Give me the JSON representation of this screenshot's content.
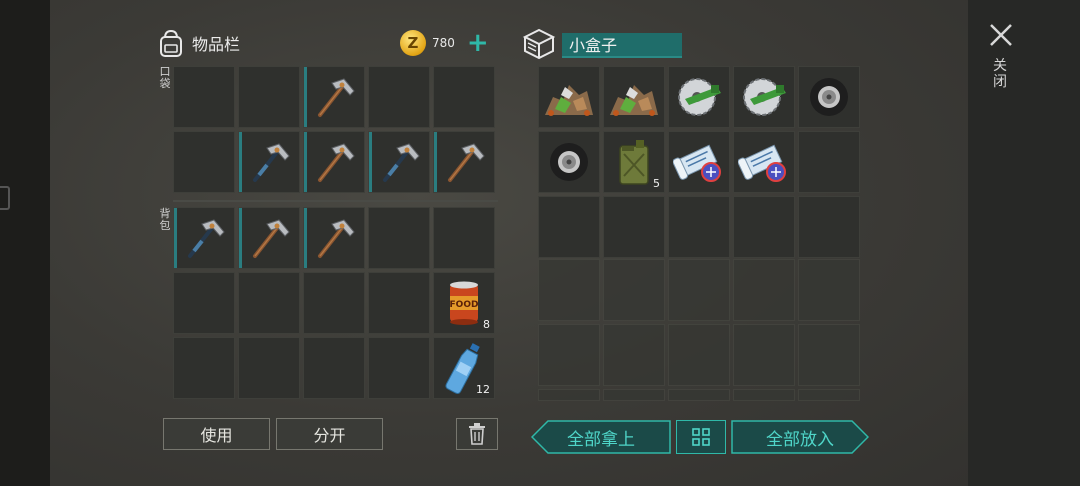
{
  "inventory": {
    "title": "物品栏",
    "coin_symbol": "Z",
    "coins": "780",
    "add_coins": "+",
    "pocket_label": "口袋",
    "backpack_label": "背包",
    "pocket": [
      {
        "icon": ""
      },
      {
        "icon": ""
      },
      {
        "icon": "pickaxe",
        "equip": true
      },
      {
        "icon": ""
      },
      {
        "icon": ""
      },
      {
        "icon": ""
      },
      {
        "icon": "pickaxe-blue",
        "equip": true
      },
      {
        "icon": "pickaxe",
        "equip": true
      },
      {
        "icon": "pickaxe-blue",
        "equip": true
      },
      {
        "icon": "pickaxe",
        "equip": true
      }
    ],
    "backpack": [
      {
        "icon": "pickaxe-blue",
        "equip": true
      },
      {
        "icon": "pickaxe",
        "equip": true
      },
      {
        "icon": "pickaxe",
        "equip": true
      },
      {
        "icon": ""
      },
      {
        "icon": ""
      },
      {
        "icon": ""
      },
      {
        "icon": ""
      },
      {
        "icon": ""
      },
      {
        "icon": ""
      },
      {
        "icon": "canned-food",
        "qty": "8"
      },
      {
        "icon": ""
      },
      {
        "icon": ""
      },
      {
        "icon": ""
      },
      {
        "icon": ""
      },
      {
        "icon": "water-bottle",
        "qty": "12"
      }
    ],
    "use_button": "使用",
    "split_button": "分开"
  },
  "container": {
    "name": "小盒子",
    "slots": [
      {
        "icon": "ore-pile"
      },
      {
        "icon": "ore-pile"
      },
      {
        "icon": "saw-blade"
      },
      {
        "icon": "saw-blade"
      },
      {
        "icon": "tire"
      },
      {
        "icon": "tire"
      },
      {
        "icon": "fuel-can",
        "qty": "5"
      },
      {
        "icon": "blueprint-scroll"
      },
      {
        "icon": "blueprint-scroll"
      },
      {
        "icon": ""
      },
      {
        "icon": ""
      },
      {
        "icon": ""
      },
      {
        "icon": ""
      },
      {
        "icon": ""
      },
      {
        "icon": ""
      }
    ],
    "locked_rows": 3,
    "take_all": "全部拿上",
    "put_all": "全部放入"
  },
  "close_label": "关闭",
  "colors": {
    "accent": "#2fb8a8",
    "teal_dark": "#1f6d6a",
    "equip_bar": "#2a7d80"
  }
}
